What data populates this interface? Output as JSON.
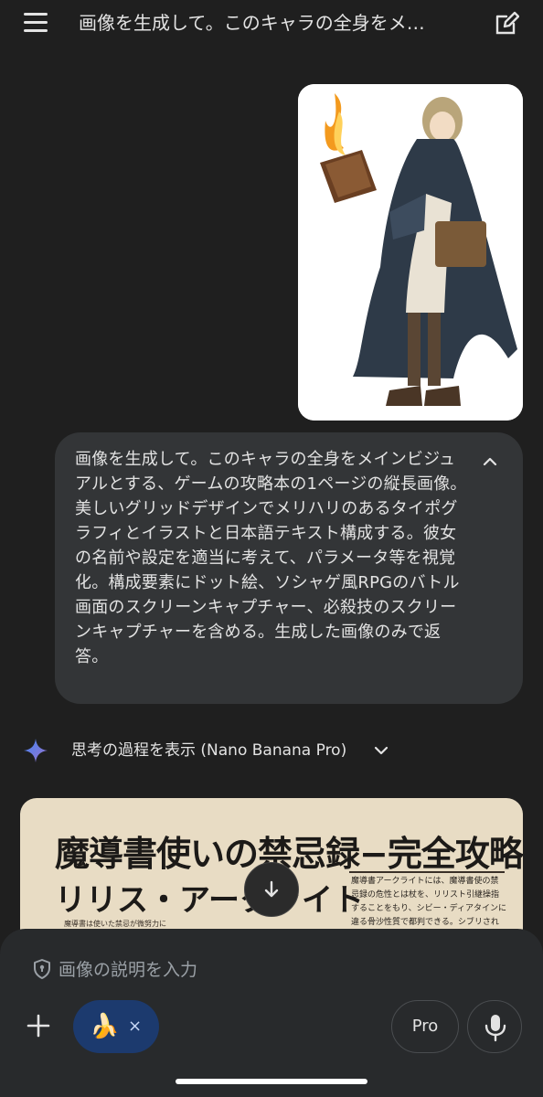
{
  "header": {
    "title": "画像を生成して。このキャラの全身をメ…",
    "menu_icon": "hamburger-menu-icon",
    "edit_icon": "edit-pencil-icon"
  },
  "conversation": {
    "user_image_alt": "character-illustration",
    "prompt": "画像を生成して。このキャラの全身をメインビジュアルとする、ゲームの攻略本の1ページの縦長画像。美しいグリッドデザインでメリハリのあるタイポグラフィとイラストと日本語テキスト構成する。彼女の名前や設定を適当に考えて、パラメータ等を視覚化。構成要素にドット絵、ソシャゲ風RPGのバトル画面のスクリーンキャプチャー、必殺技のスクリーンキャプチャーを含める。生成した画像のみで返答。",
    "thoughts_label": "思考の過程を表示 (Nano Banana Pro)",
    "generated": {
      "title_line1": "魔導書使いの禁忌録−完全攻略",
      "title_line2": "リリス・アークライト",
      "body": "魔導書アークライトには、魔導書使の禁忌録の危性とは杖を、リリスト引継操指することをもり、シビー・ディアタインに違る骨沙性質で都判できる。シブリされる、魔道書アークライトを",
      "caption": "魔導書は使いた禁忌が微努力に"
    }
  },
  "composer": {
    "placeholder": "画像の説明を入力",
    "chip_emoji": "🍌",
    "chip_close": "×",
    "pro_label": "Pro"
  },
  "colors": {
    "background": "#1f1f1f",
    "bubble": "#333537",
    "panel": "#282a2c",
    "chip": "#1c3a6e",
    "gemini_blue": "#4285f4"
  }
}
